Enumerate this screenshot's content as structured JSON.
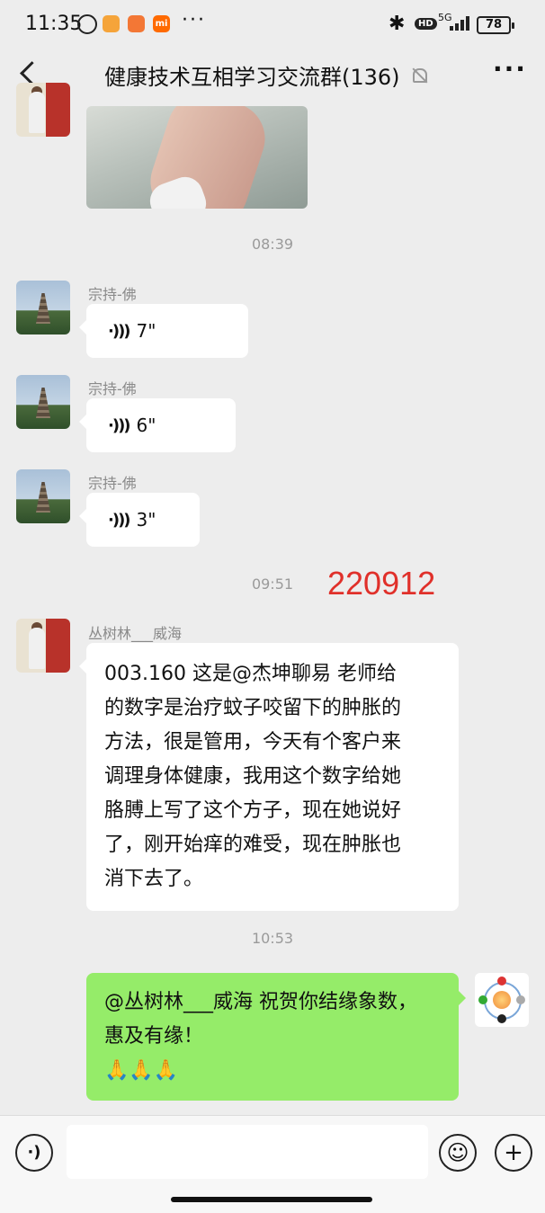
{
  "status_bar": {
    "time": "11:35",
    "app3_label": "mi",
    "more": "···",
    "hd": "HD",
    "network": "5G",
    "battery": "78"
  },
  "header": {
    "title": "健康技术互相学习交流群(136)",
    "more": "···"
  },
  "messages": [
    {
      "type": "image",
      "side": "left"
    },
    {
      "type": "time",
      "text": "08:39"
    },
    {
      "type": "voice",
      "sender": "宗持-佛",
      "duration": "7\""
    },
    {
      "type": "voice",
      "sender": "宗持-佛",
      "duration": "6\""
    },
    {
      "type": "voice",
      "sender": "宗持-佛",
      "duration": "3\""
    },
    {
      "type": "time",
      "text": "09:51"
    },
    {
      "type": "text",
      "sender": "丛树林___威海",
      "lines": [
        "003.160 这是@杰坤聊易  老师给",
        "的数字是治疗蚊子咬留下的肿胀的",
        "方法，很是管用，今天有个客户来",
        "调理身体健康，我用这个数字给她",
        "胳膊上写了这个方子，现在她说好",
        "了，刚开始痒的难受，现在肿胀也",
        "消下去了。"
      ]
    },
    {
      "type": "time",
      "text": "10:53"
    },
    {
      "type": "text",
      "side": "right",
      "lines": [
        "@丛树林___威海  祝贺你结缘象数，",
        "惠及有缘！",
        "🙏🙏🙏"
      ]
    }
  ],
  "annotation": "220912",
  "input": {
    "placeholder": ""
  },
  "colors": {
    "background": "#ededed",
    "my_bubble": "#95ec69",
    "annotation": "#e0302a"
  }
}
